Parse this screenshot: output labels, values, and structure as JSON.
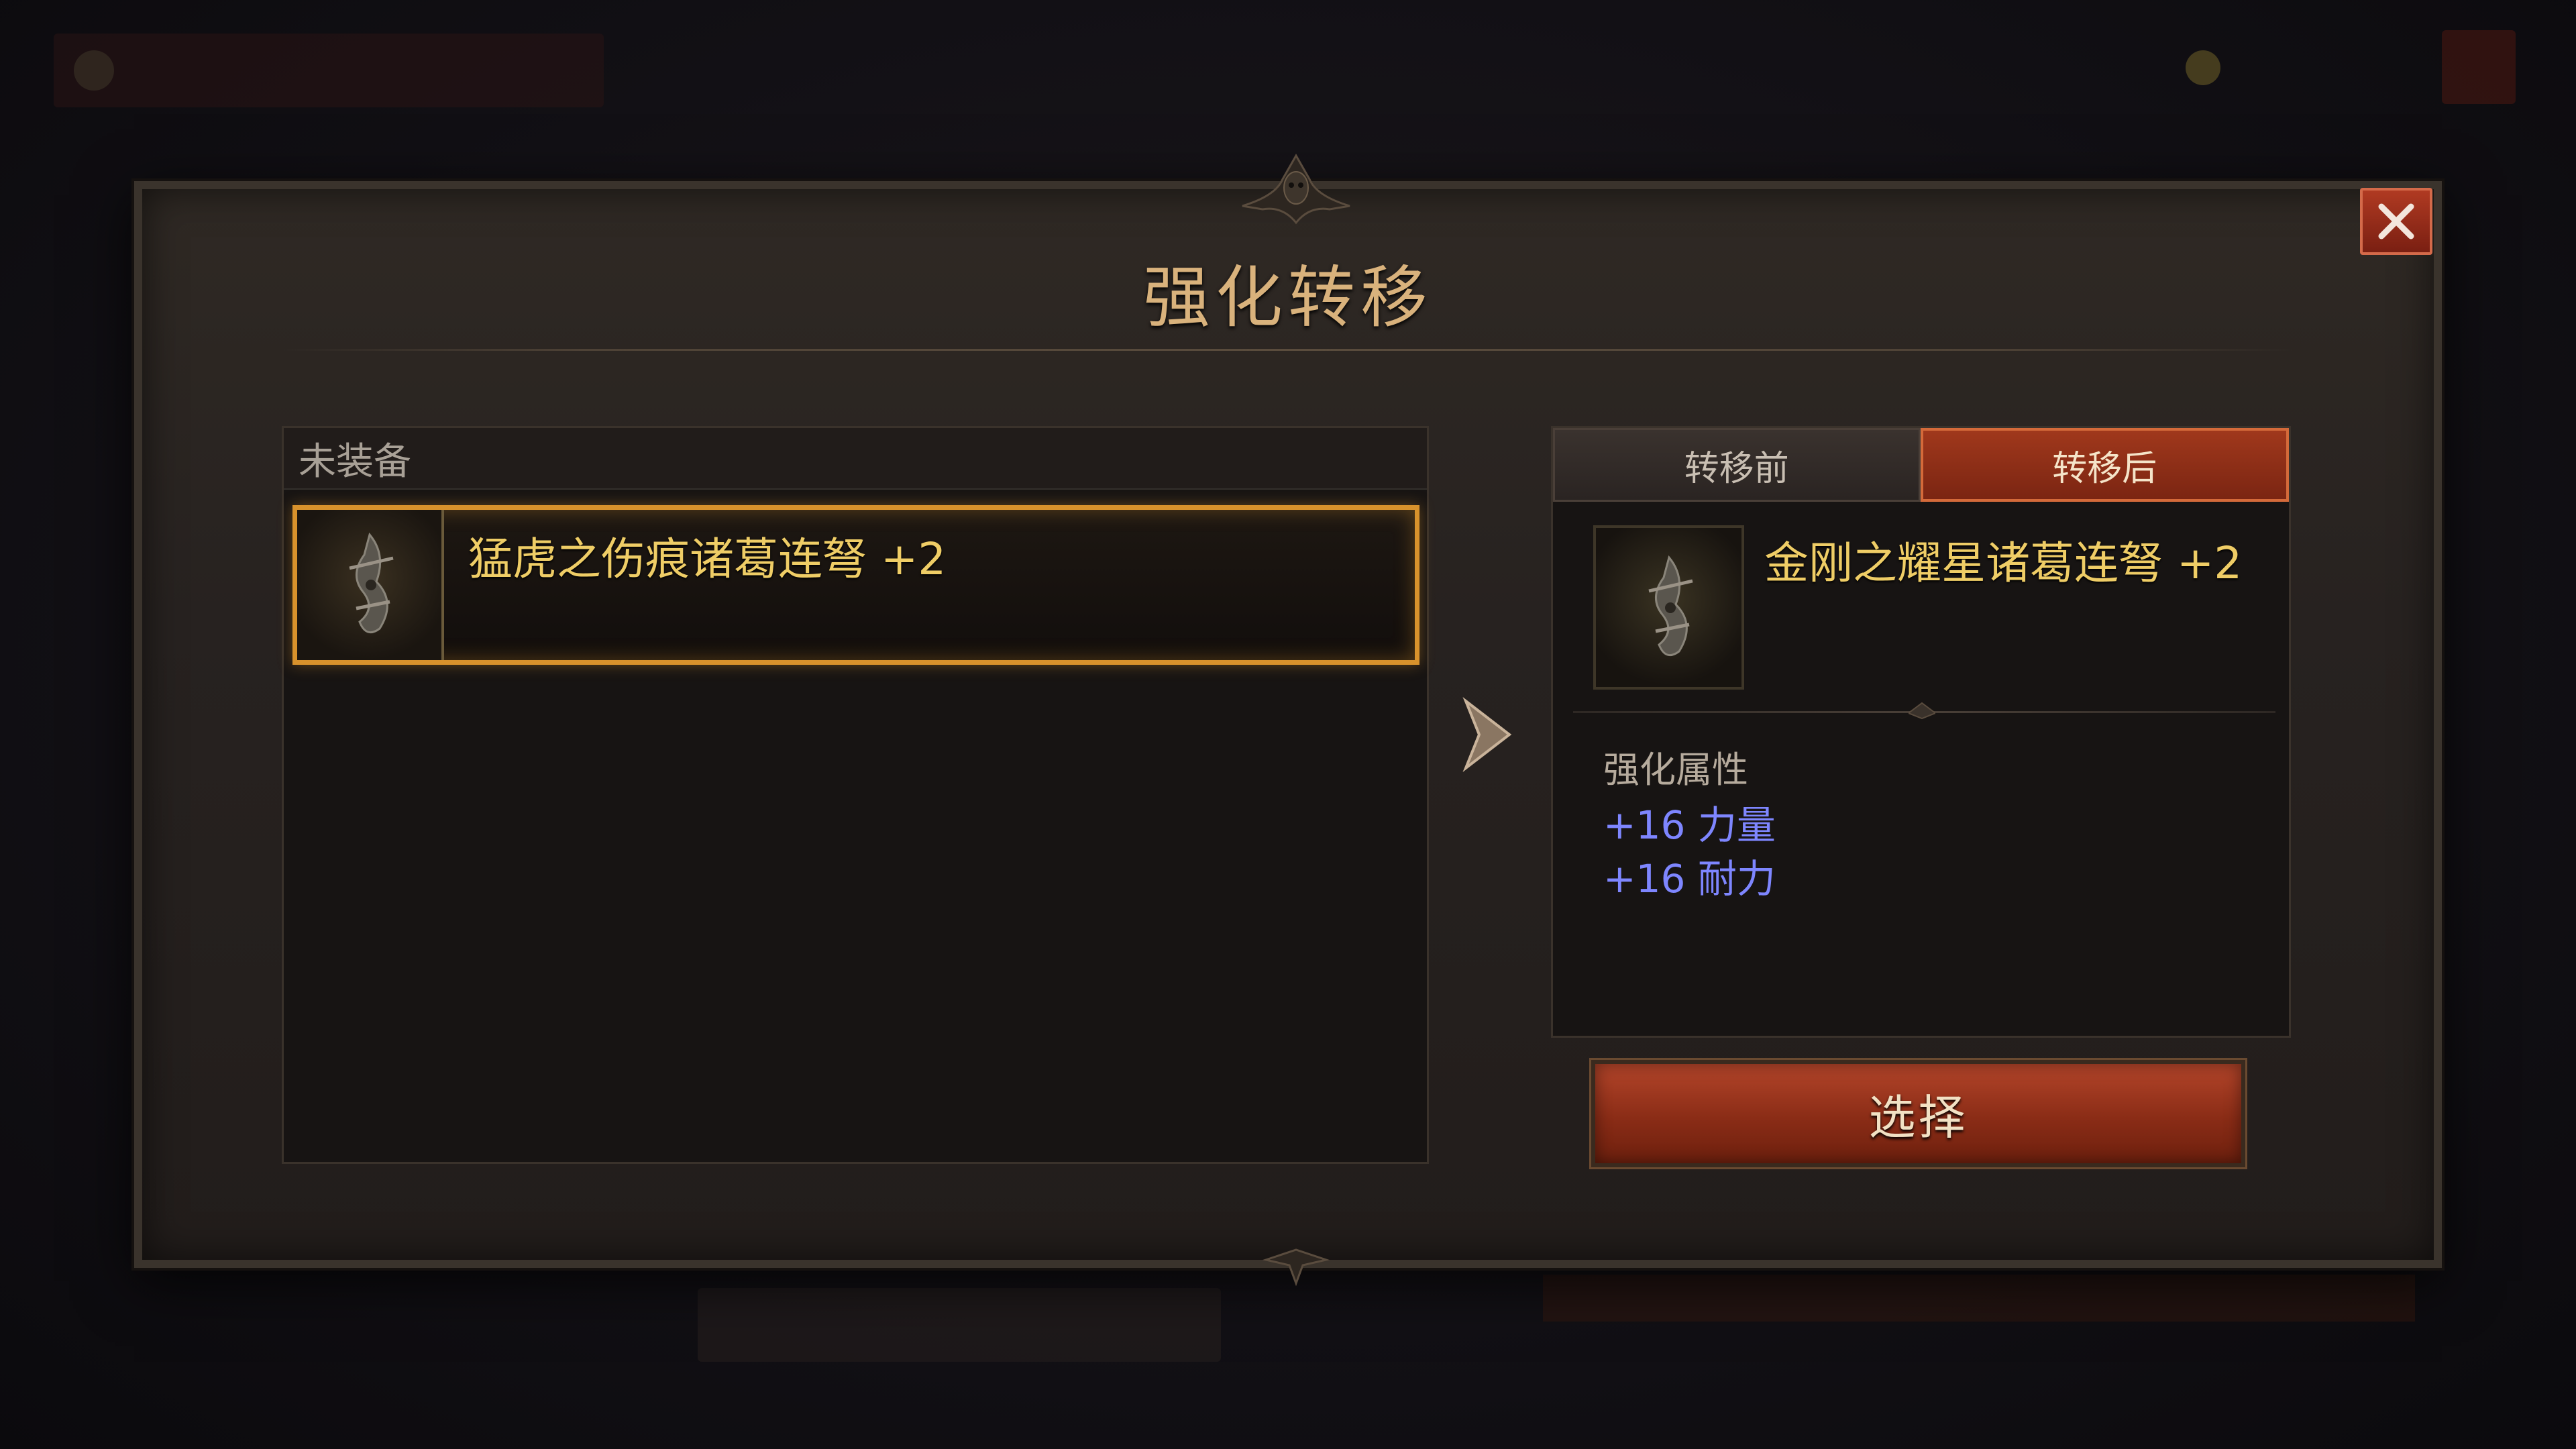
{
  "dialog": {
    "title": "强化转移"
  },
  "left_panel": {
    "header": "未装备",
    "items": [
      {
        "name": "猛虎之伤痕诸葛连弩 +2",
        "icon": "crossbow-icon",
        "selected": true
      }
    ]
  },
  "right_panel": {
    "tabs": [
      {
        "label": "转移前",
        "active": false
      },
      {
        "label": "转移后",
        "active": true
      }
    ],
    "result_item": {
      "name": "金刚之耀星诸葛连弩 +2",
      "icon": "crossbow-icon"
    },
    "attributes": {
      "title": "强化属性",
      "lines": [
        "+16 力量",
        "+16 耐力"
      ]
    }
  },
  "buttons": {
    "select": "选择"
  },
  "colors": {
    "accent_gold": "#d8922c",
    "item_name": "#efcd66",
    "attr_blue": "#7e86ff",
    "button_red": "#a0381c"
  }
}
